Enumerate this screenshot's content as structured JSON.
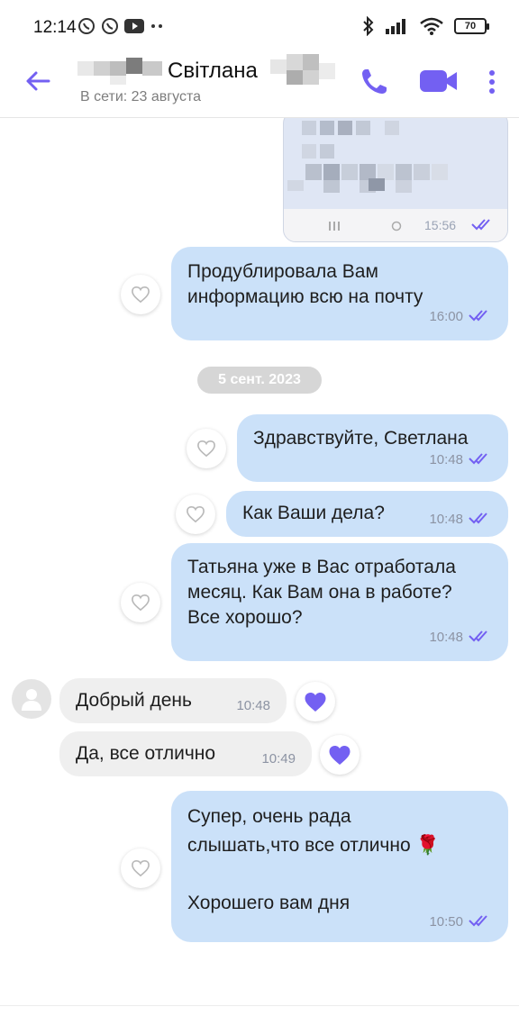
{
  "status_bar": {
    "time": "12:14",
    "battery": "70",
    "left_icons": [
      "viber-icon",
      "viber-icon",
      "youtube-icon",
      "more-dots-icon"
    ],
    "right_icons": [
      "bluetooth-icon",
      "signal-icon",
      "wifi-icon",
      "battery-icon"
    ]
  },
  "header": {
    "contact_name": "Світлана",
    "last_seen": "В сети: 23 августа",
    "accent_color": "#7360f2"
  },
  "chat": {
    "image_message": {
      "time": "15:56",
      "read": true
    },
    "messages": [
      {
        "id": "m1",
        "direction": "out",
        "text": "Продублировала Вам\nинформацию всю на почту",
        "time": "16:00",
        "liked": false
      },
      {
        "id": "m2",
        "direction": "out",
        "text": "Здравствуйте, Светлана",
        "time": "10:48",
        "liked": false
      },
      {
        "id": "m3",
        "direction": "out",
        "text": "Как Ваши дела?",
        "time": "10:48",
        "liked": false
      },
      {
        "id": "m4",
        "direction": "out",
        "text": "Татьяна уже в Вас отработала\nмесяц. Как Вам она в работе?\nВсе хорошо?",
        "time": "10:48",
        "liked": false
      },
      {
        "id": "m5",
        "direction": "in",
        "text": "Добрый день",
        "time": "10:48",
        "liked": true
      },
      {
        "id": "m6",
        "direction": "in",
        "text": "Да, все отлично",
        "time": "10:49",
        "liked": true
      },
      {
        "id": "m7",
        "direction": "out",
        "text": "Супер, очень рада\nслышать,что все отлично 🌹\n\nХорошего вам дня",
        "time": "10:50",
        "liked": false
      }
    ],
    "date_separator": "5 сент. 2023"
  },
  "colors": {
    "outgoing_bubble": "#cbe1f9",
    "incoming_bubble": "#efefef",
    "heart_liked": "#7360f2",
    "read_ticks": "#7360f2"
  }
}
